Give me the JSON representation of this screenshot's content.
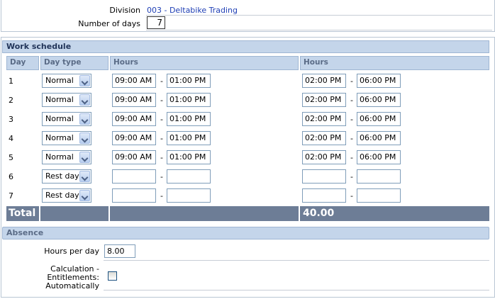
{
  "header": {
    "division_label": "Division",
    "division_value": "003 - Deltabike Trading",
    "days_label": "Number of days",
    "days_value": "7"
  },
  "schedule": {
    "title": "Work schedule",
    "columns": {
      "day": "Day",
      "day_type": "Day type",
      "hours1": "Hours",
      "hours2": "Hours"
    },
    "rows": [
      {
        "day": "1",
        "type": "Normal",
        "am_from": "09:00 AM",
        "am_to": "01:00 PM",
        "pm_from": "02:00 PM",
        "pm_to": "06:00 PM"
      },
      {
        "day": "2",
        "type": "Normal",
        "am_from": "09:00 AM",
        "am_to": "01:00 PM",
        "pm_from": "02:00 PM",
        "pm_to": "06:00 PM"
      },
      {
        "day": "3",
        "type": "Normal",
        "am_from": "09:00 AM",
        "am_to": "01:00 PM",
        "pm_from": "02:00 PM",
        "pm_to": "06:00 PM"
      },
      {
        "day": "4",
        "type": "Normal",
        "am_from": "09:00 AM",
        "am_to": "01:00 PM",
        "pm_from": "02:00 PM",
        "pm_to": "06:00 PM"
      },
      {
        "day": "5",
        "type": "Normal",
        "am_from": "09:00 AM",
        "am_to": "01:00 PM",
        "pm_from": "02:00 PM",
        "pm_to": "06:00 PM"
      },
      {
        "day": "6",
        "type": "Rest day",
        "am_from": "",
        "am_to": "",
        "pm_from": "",
        "pm_to": ""
      },
      {
        "day": "7",
        "type": "Rest day",
        "am_from": "",
        "am_to": "",
        "pm_from": "",
        "pm_to": ""
      }
    ],
    "separator": "-",
    "total_label": "Total",
    "total_value": "40.00"
  },
  "absence": {
    "title": "Absence",
    "hours_per_day_label": "Hours per day",
    "hours_per_day_value": "8.00",
    "calc_label_1": "Calculation -",
    "calc_label_2": "Entitlements:",
    "calc_label_3": "Automatically"
  },
  "colors": {
    "header_bg": "#c4d5ea",
    "total_bg": "#6d7d96",
    "link": "#1f3fb5"
  },
  "icons": {
    "dropdown": "chevron-down-icon",
    "checkbox": "checkbox"
  }
}
